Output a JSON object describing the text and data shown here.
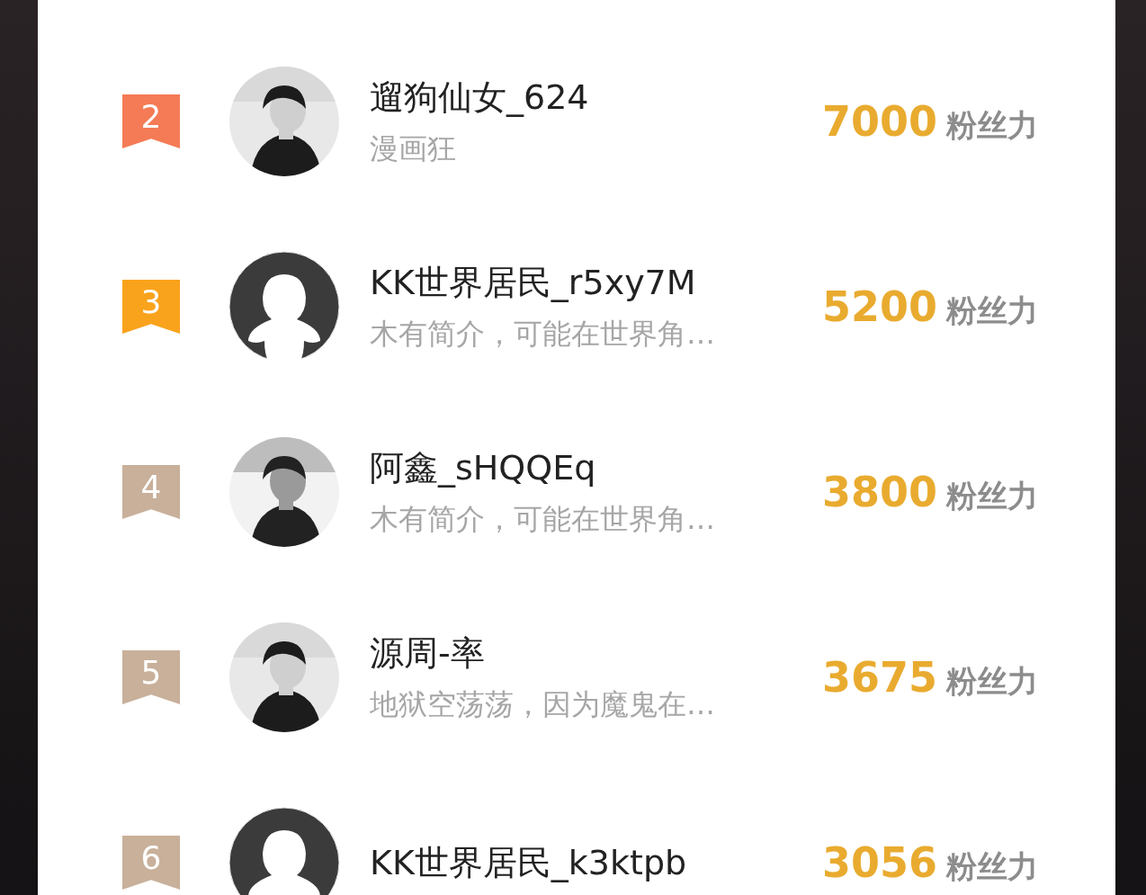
{
  "ranking": [
    {
      "rank": "2",
      "color": "#f47b55",
      "name": "遛狗仙女_624",
      "bio": "漫画狂",
      "score": "7000",
      "unit": "粉丝力"
    },
    {
      "rank": "3",
      "color": "#f9a31c",
      "avatar": {
        "kind": "default"
      },
      "name": "KK世界居民_r5xy7M",
      "bio": "木有简介，可能在世界角…",
      "score": "5200",
      "unit": "粉丝力"
    },
    {
      "rank": "4",
      "color": "#c8b09a",
      "name": "阿鑫_sHQQEq",
      "bio": "木有简介，可能在世界角…",
      "score": "3800",
      "unit": "粉丝力"
    },
    {
      "rank": "5",
      "color": "#c8b09a",
      "name": "源周-率",
      "bio": "地狱空荡荡，因为魔鬼在…",
      "score": "3675",
      "unit": "粉丝力"
    },
    {
      "rank": "6",
      "color": "#c8b09a",
      "avatar": {
        "kind": "default"
      },
      "name": "KK世界居民_k3ktpb",
      "score": "3056",
      "unit": "粉丝力"
    }
  ]
}
